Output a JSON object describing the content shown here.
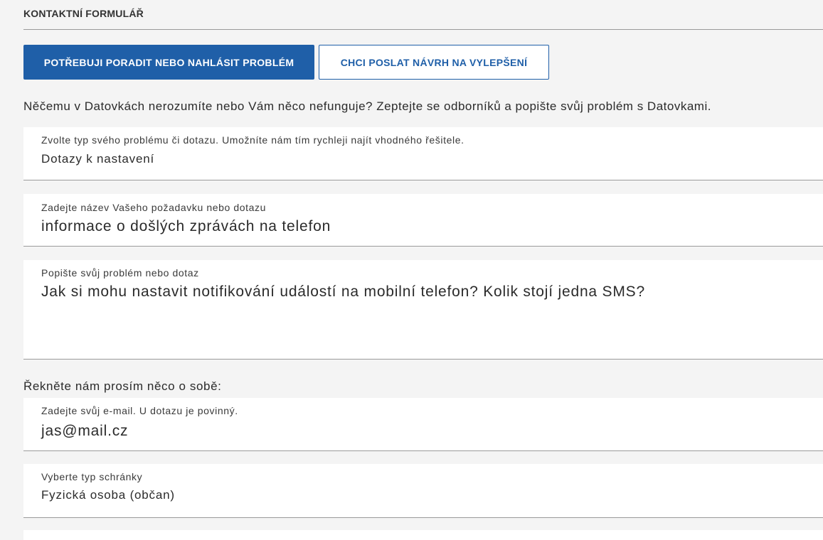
{
  "form": {
    "title": "KONTAKTNÍ FORMULÁŘ"
  },
  "tabs": {
    "primary_label": "POTŘEBUJI PORADIT NEBO NAHLÁSIT PROBLÉM",
    "secondary_label": "CHCI POSLAT NÁVRH NA VYLEPŠENÍ"
  },
  "intro_text": "Něčemu v Datovkách nerozumíte nebo Vám něco nefunguje? Zeptejte se odborníků a popište svůj problém s Datovkami.",
  "fields": {
    "problem_type": {
      "label": "Zvolte typ svého problému či dotazu. Umožníte nám tím rychleji najít vhodného řešitele.",
      "value": "Dotazy k nastavení"
    },
    "request_title": {
      "label": "Zadejte název Vašeho požadavku nebo dotazu",
      "value": "informace o došlých zprávách na telefon"
    },
    "description": {
      "label": "Popište svůj problém nebo dotaz",
      "value": "Jak si mohu nastavit notifikování událostí na mobilní telefon? Kolik stojí jedna SMS?"
    },
    "email": {
      "label": "Zadejte svůj e-mail. U dotazu je povinný.",
      "value": "jas@mail.cz"
    },
    "mailbox_type": {
      "label": "Vyberte typ schránky",
      "value": "Fyzická osoba (občan)"
    }
  },
  "about_heading": "Řekněte nám prosím něco o sobě:",
  "colors": {
    "accent": "#1f5fa8",
    "background": "#f4f4f4",
    "field_background": "#ffffff",
    "divider": "#9a9a9a"
  }
}
